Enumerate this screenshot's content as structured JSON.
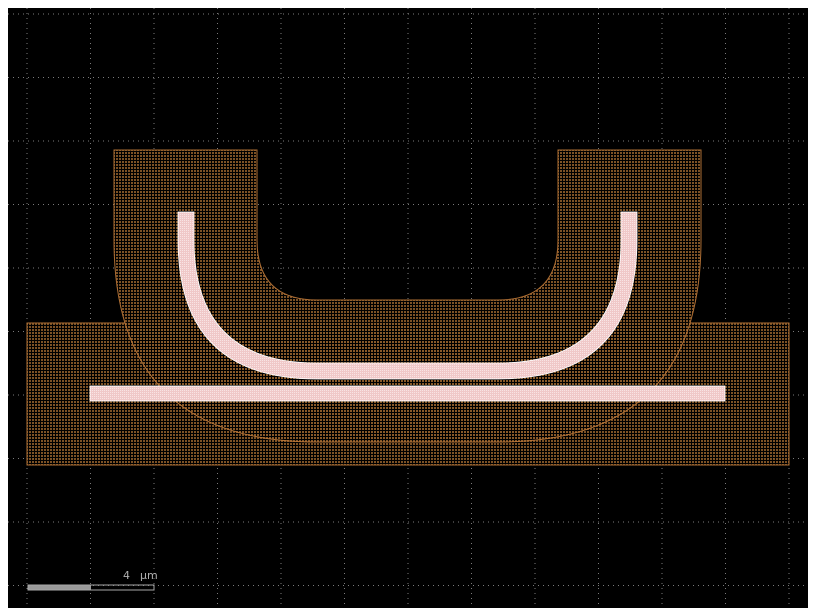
{
  "canvas": {
    "background_color": "#000000",
    "grid_color": "#9a9a9a",
    "grid": true
  },
  "layers": {
    "cladding": {
      "fill": "#8a5a2a",
      "stroke": "#c07a3a"
    },
    "core": {
      "fill": "#f0c8c8",
      "stroke": "#ffffff"
    }
  },
  "scale_bar": {
    "value": "4",
    "unit": "µm",
    "color": "#a8a8a8"
  }
}
